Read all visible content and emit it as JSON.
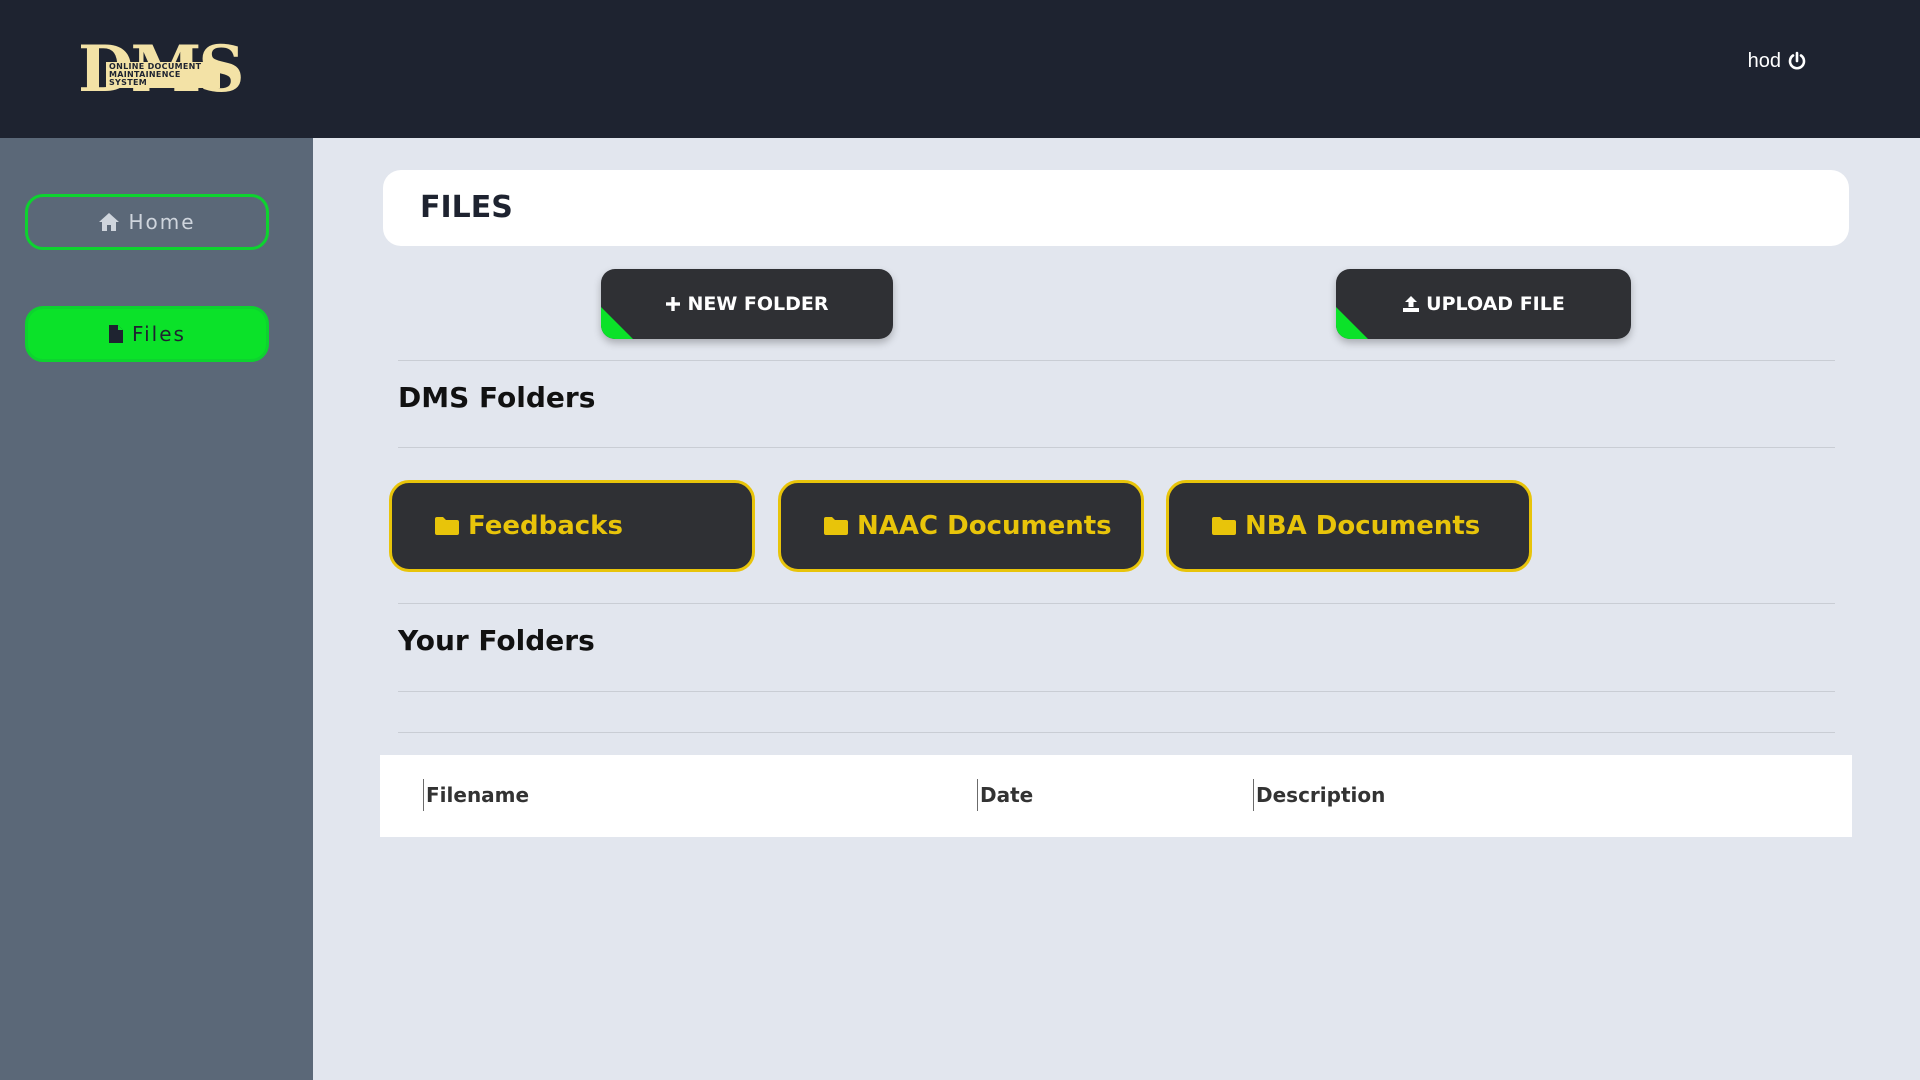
{
  "header": {
    "logo_text": "DMS",
    "logo_tagline": "ONLINE DOCUMENT MAINTAINENCE SYSTEM",
    "username": "hod",
    "logout_icon": "power-icon"
  },
  "sidebar": {
    "items": [
      {
        "label": "Home",
        "icon": "home-icon",
        "active": false
      },
      {
        "label": "Files",
        "icon": "file-icon",
        "active": true
      }
    ]
  },
  "page": {
    "title": "FILES"
  },
  "actions": {
    "new_folder": "NEW FOLDER",
    "upload_file": "UPLOAD FILE"
  },
  "sections": {
    "dms_folders": "DMS Folders",
    "your_folders": "Your Folders"
  },
  "dms_folders": [
    {
      "label": "Feedbacks",
      "icon": "folder-icon"
    },
    {
      "label": "NAAC Documents",
      "icon": "folder-icon"
    },
    {
      "label": "NBA Documents",
      "icon": "folder-icon"
    }
  ],
  "table": {
    "columns": [
      "Filename",
      "Date",
      "Description"
    ]
  },
  "colors": {
    "topbar": "#1e2330",
    "sidebar": "#5b6878",
    "accent_green": "#0be229",
    "folder_yellow": "#e8c40a",
    "button_dark": "#2f3034",
    "background": "#e2e6ee"
  }
}
